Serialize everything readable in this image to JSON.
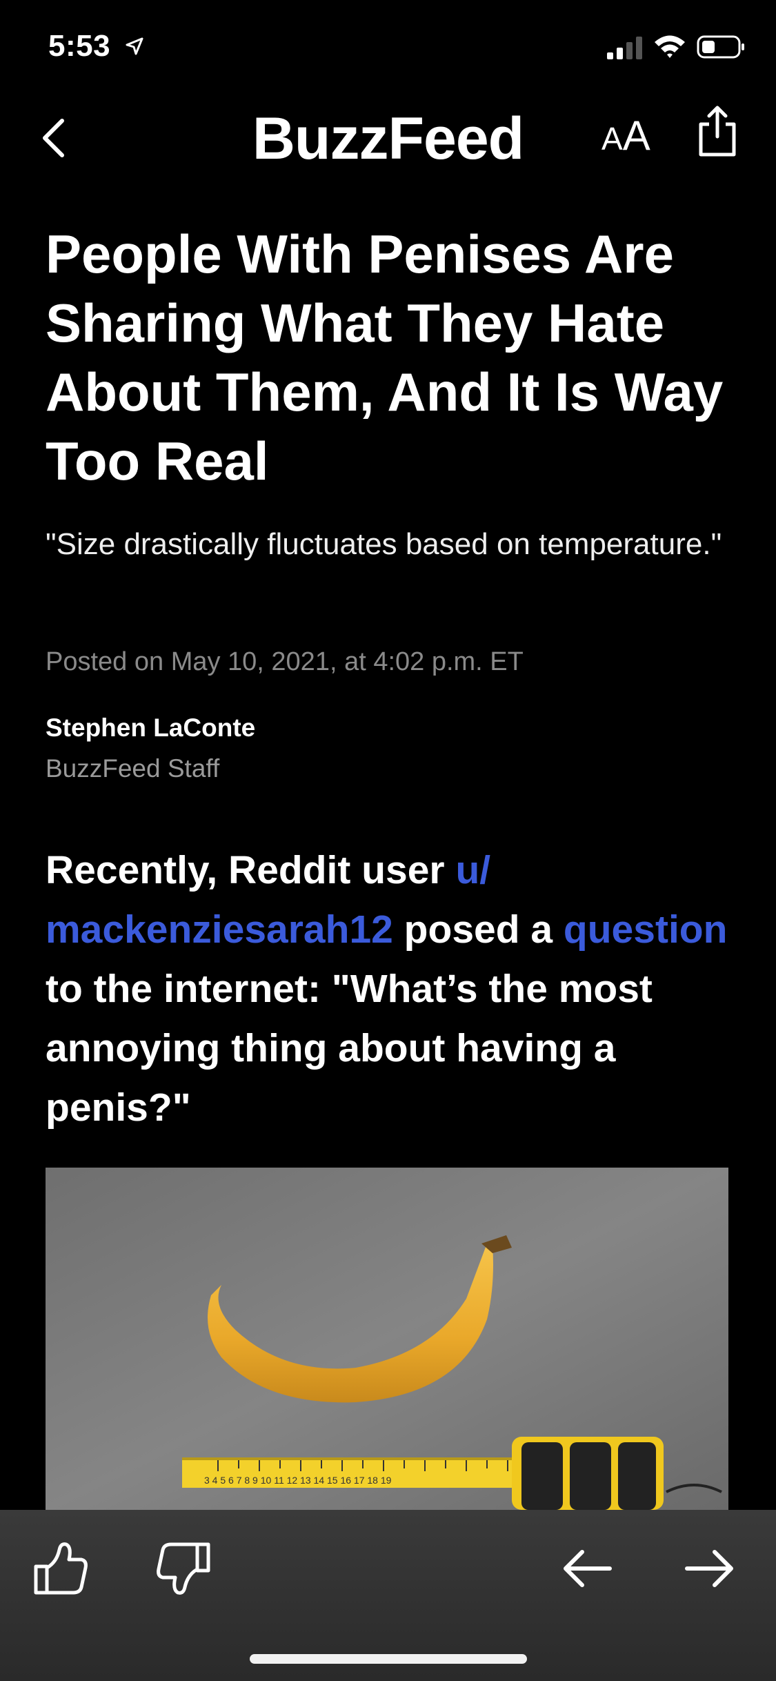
{
  "status_bar": {
    "time": "5:53",
    "icons": [
      "location-arrow-icon",
      "cellular-signal-icon",
      "wifi-icon",
      "battery-icon"
    ]
  },
  "nav": {
    "brand": "BuzzFeed",
    "text_size_label_small": "A",
    "text_size_label_large": "A",
    "icons": [
      "back-chevron-icon",
      "share-icon"
    ]
  },
  "article": {
    "headline": "People With Penises Are Sharing What They Hate About Them, And It Is Way Too Real",
    "subhead": "\"Size drastically fluctuates based on temperature.\"",
    "posted": "Posted on May 10, 2021, at 4:02 p.m. ET",
    "author_name": "Stephen LaConte",
    "author_role": "BuzzFeed Staff",
    "body": {
      "part1": "Recently, Reddit user ",
      "link_user": "u/ mackenziesarah12",
      "part2": " posed a ",
      "link_question": "question",
      "part3": " to the internet: \"What’s the most annoying thing about having a penis?\""
    },
    "image_tape_numbers": "3 4 5 6 7 8 9 10 11 12 13 14 15 16 17 18 19"
  },
  "toolbar": {
    "icons": [
      "thumbs-up-icon",
      "thumbs-down-icon",
      "arrow-left-icon",
      "arrow-right-icon"
    ]
  },
  "colors": {
    "background": "#000000",
    "link": "#3b5bdb",
    "muted": "#8a8a8a",
    "toolbar": "#333333"
  }
}
